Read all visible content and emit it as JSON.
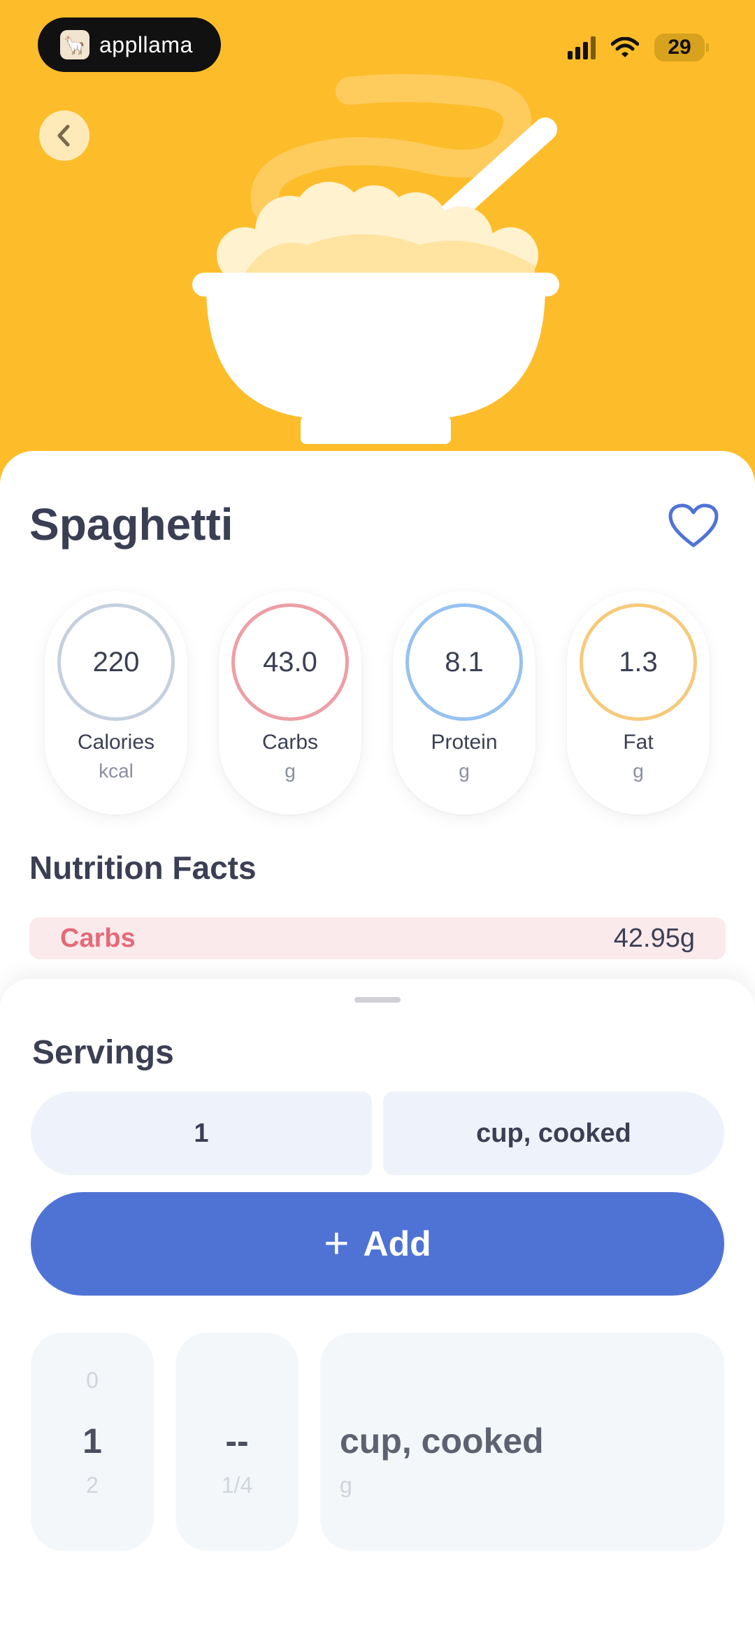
{
  "status_bar": {
    "app_brand": "appllama",
    "battery": "29",
    "icons": [
      "llama-logo-icon",
      "signal-icon",
      "wifi-icon",
      "battery-icon"
    ]
  },
  "header": {
    "back_icon": "chevron-left-icon",
    "illustration": "cereal-bowl-illustration"
  },
  "food": {
    "name": "Spaghetti",
    "favorite_icon": "heart-outline-icon"
  },
  "macros": [
    {
      "value": "220",
      "label": "Calories",
      "unit": "kcal",
      "color": "#c5d0df"
    },
    {
      "value": "43.0",
      "label": "Carbs",
      "unit": "g",
      "color": "#ee9ea6"
    },
    {
      "value": "8.1",
      "label": "Protein",
      "unit": "g",
      "color": "#96c2f0"
    },
    {
      "value": "1.3",
      "label": "Fat",
      "unit": "g",
      "color": "#f6ca7b"
    }
  ],
  "nutrition": {
    "title": "Nutrition Facts",
    "rows": [
      {
        "label": "Carbs",
        "value": "42.95g"
      }
    ]
  },
  "servings": {
    "title": "Servings",
    "quantity": "1",
    "unit": "cup, cooked",
    "add_label": "Add"
  },
  "picker": {
    "whole": {
      "above": "0",
      "selected": "1",
      "below": "2"
    },
    "fraction": {
      "selected": "--",
      "below": "1/4"
    },
    "unit": {
      "selected": "cup, cooked",
      "below": "g"
    }
  },
  "colors": {
    "hero_bg": "#fdbd2a",
    "accent": "#4f73d5",
    "carbs_row_bg": "#fbeaec",
    "carbs_text": "#e46a78"
  }
}
